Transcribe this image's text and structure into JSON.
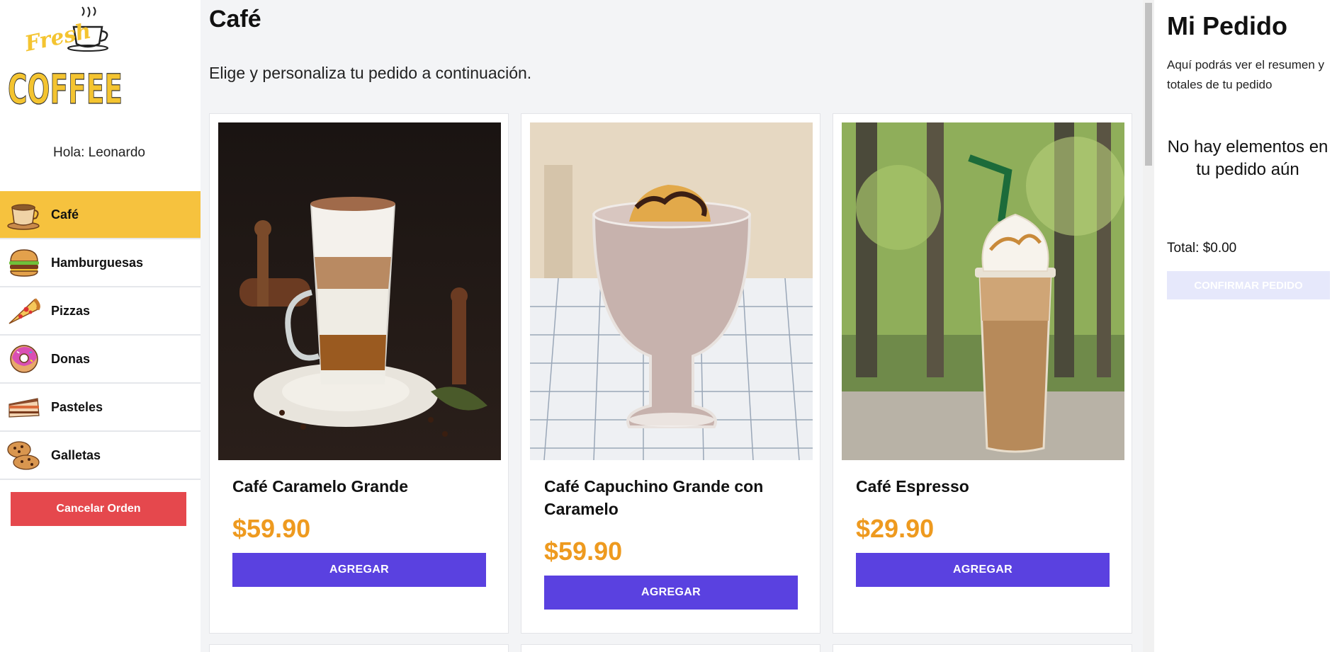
{
  "brand": {
    "logo_script": "Fresh",
    "logo_main": "COFFEE"
  },
  "sidebar": {
    "greeting": "Hola: Leonardo",
    "categories": [
      {
        "label": "Café",
        "icon": "coffee-cup-icon",
        "active": true
      },
      {
        "label": "Hamburguesas",
        "icon": "burger-icon",
        "active": false
      },
      {
        "label": "Pizzas",
        "icon": "pizza-slice-icon",
        "active": false
      },
      {
        "label": "Donas",
        "icon": "donut-icon",
        "active": false
      },
      {
        "label": "Pasteles",
        "icon": "cake-slice-icon",
        "active": false
      },
      {
        "label": "Galletas",
        "icon": "cookies-icon",
        "active": false
      }
    ],
    "cancel_label": "Cancelar Orden"
  },
  "main": {
    "title": "Café",
    "subtitle": "Elige y personaliza tu pedido a continuación.",
    "products": [
      {
        "name": "Café Caramelo Grande",
        "price": "$59.90",
        "button": "AGREGAR",
        "image": "layered-latte-photo"
      },
      {
        "name": "Café Capuchino Grande con Caramelo",
        "price": "$59.90",
        "button": "AGREGAR",
        "image": "mocha-frappe-glass-photo"
      },
      {
        "name": "Café Espresso",
        "price": "$29.90",
        "button": "AGREGAR",
        "image": "iced-frappe-cup-photo"
      }
    ]
  },
  "order": {
    "title": "Mi Pedido",
    "description": "Aquí podrás ver el resumen y totales de tu pedido",
    "empty_message": "No hay elementos en tu pedido aún",
    "total": "Total: $0.00",
    "confirm_label": "CONFIRMAR PEDIDO"
  },
  "colors": {
    "active_category": "#f6c23e",
    "cancel": "#e5484d",
    "price": "#ee9a1f",
    "add_button": "#5a41e0",
    "confirm_disabled": "#e6e8fb"
  }
}
